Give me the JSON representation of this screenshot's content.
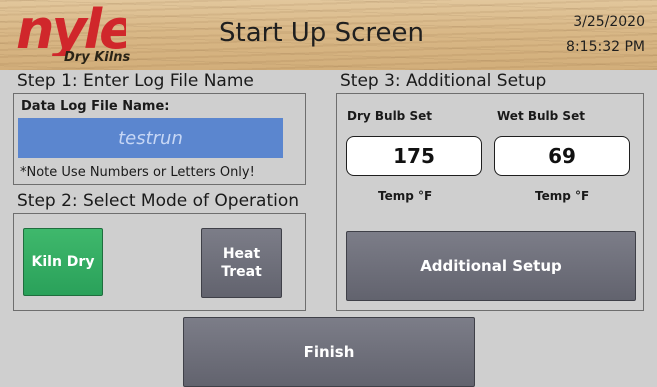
{
  "header": {
    "brand_name": "nyle",
    "brand_sub": "Dry Kilns",
    "title": "Start Up Screen",
    "date": "3/25/2020",
    "time": "8:15:32 PM",
    "brand_color": "#d0272b"
  },
  "step1": {
    "heading": "Step 1:  Enter Log File Name",
    "field_label": "Data Log File Name:",
    "field_value": "testrun",
    "note": "*Note Use Numbers or Letters Only!"
  },
  "step2": {
    "heading": "Step 2:  Select Mode of Operation",
    "kiln_dry_label": "Kiln Dry",
    "heat_treat_label_line1": "Heat",
    "heat_treat_label_line2": "Treat"
  },
  "step3": {
    "heading": "Step 3:  Additional Setup",
    "dry_bulb_label": "Dry Bulb Set",
    "wet_bulb_label": "Wet Bulb Set",
    "dry_bulb_value": "175",
    "wet_bulb_value": "69",
    "dry_unit": "Temp °F",
    "wet_unit": "Temp °F",
    "additional_setup_label": "Additional Setup"
  },
  "footer": {
    "finish_label": "Finish"
  }
}
